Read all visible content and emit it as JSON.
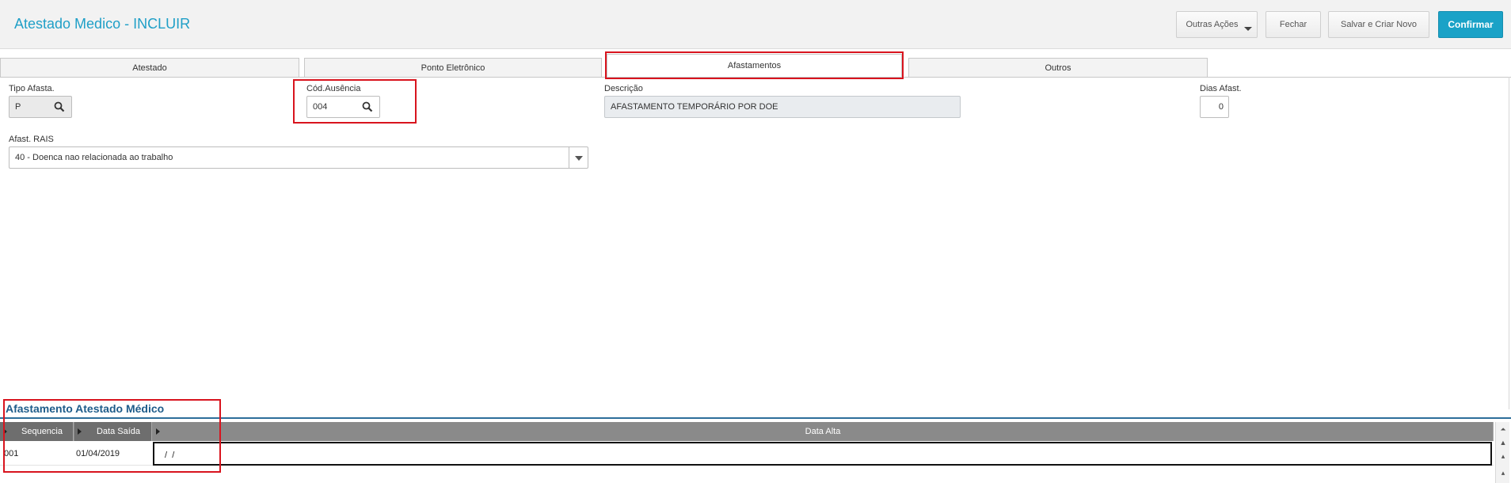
{
  "header": {
    "title": "Atestado Medico - INCLUIR",
    "buttons": {
      "other_actions": "Outras Ações",
      "close": "Fechar",
      "save_new": "Salvar e Criar Novo",
      "confirm": "Confirmar"
    }
  },
  "tabs": [
    {
      "label": "Atestado",
      "active": false
    },
    {
      "label": "Ponto Eletrônico",
      "active": false
    },
    {
      "label": "Afastamentos",
      "active": true
    },
    {
      "label": "Outros",
      "active": false
    }
  ],
  "form": {
    "tipo_afasta": {
      "label": "Tipo Afasta.",
      "value": "P",
      "icon": "search-icon"
    },
    "cod_ausencia": {
      "label": "Cód.Ausência",
      "value": "004",
      "icon": "search-icon"
    },
    "descricao": {
      "label": "Descrição",
      "value": "AFASTAMENTO TEMPORÁRIO POR DOE"
    },
    "dias_afast": {
      "label": "Dias Afast.",
      "value": "0"
    },
    "afast_rais": {
      "label": "Afast. RAIS",
      "value": "40 - Doenca nao relacionada ao trabalho",
      "icon": "chevron-down-icon"
    }
  },
  "grid": {
    "title": "Afastamento Atestado Médico",
    "columns": [
      "Sequencia",
      "Data Saída",
      "Data Alta"
    ],
    "rows": [
      {
        "sequencia": "001",
        "data_saida": "01/04/2019",
        "data_alta": " /  /"
      }
    ]
  },
  "colors": {
    "title": "#1f9fc7",
    "primary_button": "#1aa2c7",
    "highlight": "#d8141e",
    "section_title": "#1e5c8a",
    "grid_header": "#8a8a8a"
  }
}
